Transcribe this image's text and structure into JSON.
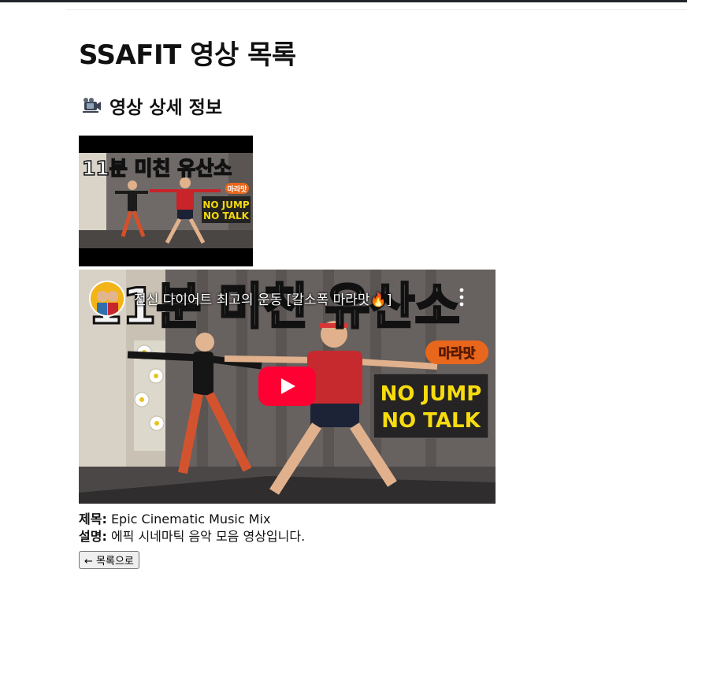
{
  "header": {
    "title": "SSAFIT 영상 목록"
  },
  "detail": {
    "heading": "영상 상세 정보",
    "heading_icon": "video-camera-icon",
    "thumbnail": {
      "overlay_title": "11분 미친 유산소",
      "badge": "마라맛",
      "tag_line1": "NO JUMP",
      "tag_line2": "NO TALK"
    },
    "player": {
      "video_title": "전신 다이어트 최고의 운동 [칼소폭 마라맛🔥]",
      "banner_text": "11분 미친 유산소",
      "badge": "마라맛",
      "tag_line1": "NO JUMP",
      "tag_line2": "NO TALK",
      "play_icon": "youtube-play-icon",
      "more_icon": "more-vertical-icon"
    },
    "title_label": "제목:",
    "title_value": "Epic Cinematic Music Mix",
    "description_label": "설명:",
    "description_value": "에픽 시네마틱 음악 모음 영상입니다.",
    "back_button": "← 목록으로"
  },
  "colors": {
    "youtube_red": "#ff0033",
    "text": "#111111",
    "badge_orange": "#e8671c"
  }
}
